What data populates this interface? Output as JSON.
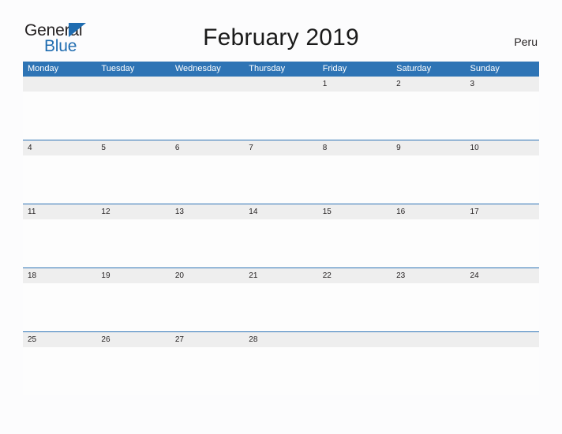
{
  "logo": {
    "word1": "General",
    "word2": "Blue",
    "icon": "triangle-flag-icon",
    "color_dark": "#231f20",
    "color_blue": "#1f6cb0"
  },
  "header": {
    "title": "February 2019",
    "country": "Peru"
  },
  "colors": {
    "header_blue": "#2e74b5",
    "date_band_gray": "#eeeeee",
    "page_background": "#fcfcfd",
    "text_dark": "#231f20"
  },
  "calendar": {
    "month": "February",
    "year": "2019",
    "weekdays": [
      "Monday",
      "Tuesday",
      "Wednesday",
      "Thursday",
      "Friday",
      "Saturday",
      "Sunday"
    ],
    "weeks": [
      [
        "",
        "",
        "",
        "",
        "1",
        "2",
        "3"
      ],
      [
        "4",
        "5",
        "6",
        "7",
        "8",
        "9",
        "10"
      ],
      [
        "11",
        "12",
        "13",
        "14",
        "15",
        "16",
        "17"
      ],
      [
        "18",
        "19",
        "20",
        "21",
        "22",
        "23",
        "24"
      ],
      [
        "25",
        "26",
        "27",
        "28",
        "",
        "",
        ""
      ]
    ]
  }
}
